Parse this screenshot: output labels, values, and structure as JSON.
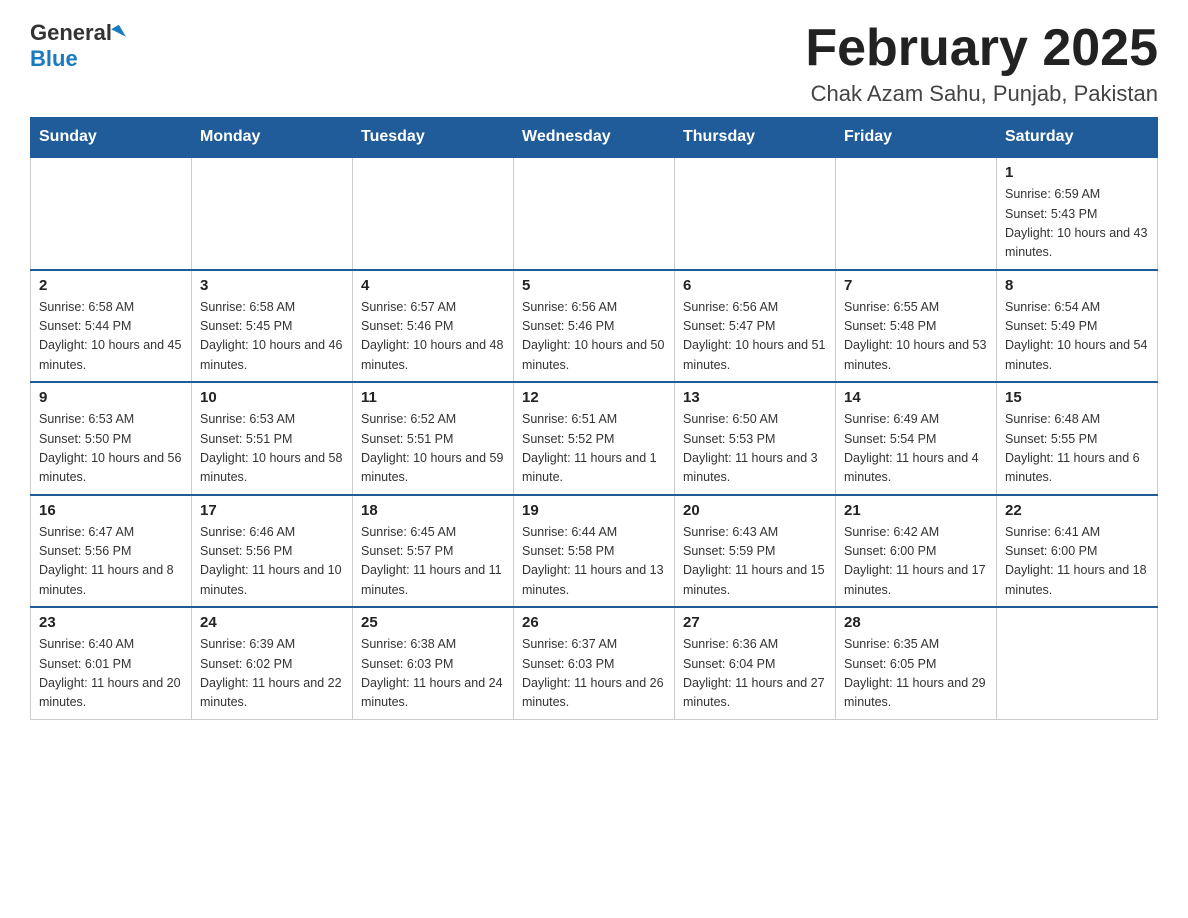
{
  "header": {
    "logo_general": "General",
    "logo_blue": "Blue",
    "title": "February 2025",
    "subtitle": "Chak Azam Sahu, Punjab, Pakistan"
  },
  "days_of_week": [
    "Sunday",
    "Monday",
    "Tuesday",
    "Wednesday",
    "Thursday",
    "Friday",
    "Saturday"
  ],
  "weeks": [
    [
      {
        "day": "",
        "info": ""
      },
      {
        "day": "",
        "info": ""
      },
      {
        "day": "",
        "info": ""
      },
      {
        "day": "",
        "info": ""
      },
      {
        "day": "",
        "info": ""
      },
      {
        "day": "",
        "info": ""
      },
      {
        "day": "1",
        "info": "Sunrise: 6:59 AM\nSunset: 5:43 PM\nDaylight: 10 hours and 43 minutes."
      }
    ],
    [
      {
        "day": "2",
        "info": "Sunrise: 6:58 AM\nSunset: 5:44 PM\nDaylight: 10 hours and 45 minutes."
      },
      {
        "day": "3",
        "info": "Sunrise: 6:58 AM\nSunset: 5:45 PM\nDaylight: 10 hours and 46 minutes."
      },
      {
        "day": "4",
        "info": "Sunrise: 6:57 AM\nSunset: 5:46 PM\nDaylight: 10 hours and 48 minutes."
      },
      {
        "day": "5",
        "info": "Sunrise: 6:56 AM\nSunset: 5:46 PM\nDaylight: 10 hours and 50 minutes."
      },
      {
        "day": "6",
        "info": "Sunrise: 6:56 AM\nSunset: 5:47 PM\nDaylight: 10 hours and 51 minutes."
      },
      {
        "day": "7",
        "info": "Sunrise: 6:55 AM\nSunset: 5:48 PM\nDaylight: 10 hours and 53 minutes."
      },
      {
        "day": "8",
        "info": "Sunrise: 6:54 AM\nSunset: 5:49 PM\nDaylight: 10 hours and 54 minutes."
      }
    ],
    [
      {
        "day": "9",
        "info": "Sunrise: 6:53 AM\nSunset: 5:50 PM\nDaylight: 10 hours and 56 minutes."
      },
      {
        "day": "10",
        "info": "Sunrise: 6:53 AM\nSunset: 5:51 PM\nDaylight: 10 hours and 58 minutes."
      },
      {
        "day": "11",
        "info": "Sunrise: 6:52 AM\nSunset: 5:51 PM\nDaylight: 10 hours and 59 minutes."
      },
      {
        "day": "12",
        "info": "Sunrise: 6:51 AM\nSunset: 5:52 PM\nDaylight: 11 hours and 1 minute."
      },
      {
        "day": "13",
        "info": "Sunrise: 6:50 AM\nSunset: 5:53 PM\nDaylight: 11 hours and 3 minutes."
      },
      {
        "day": "14",
        "info": "Sunrise: 6:49 AM\nSunset: 5:54 PM\nDaylight: 11 hours and 4 minutes."
      },
      {
        "day": "15",
        "info": "Sunrise: 6:48 AM\nSunset: 5:55 PM\nDaylight: 11 hours and 6 minutes."
      }
    ],
    [
      {
        "day": "16",
        "info": "Sunrise: 6:47 AM\nSunset: 5:56 PM\nDaylight: 11 hours and 8 minutes."
      },
      {
        "day": "17",
        "info": "Sunrise: 6:46 AM\nSunset: 5:56 PM\nDaylight: 11 hours and 10 minutes."
      },
      {
        "day": "18",
        "info": "Sunrise: 6:45 AM\nSunset: 5:57 PM\nDaylight: 11 hours and 11 minutes."
      },
      {
        "day": "19",
        "info": "Sunrise: 6:44 AM\nSunset: 5:58 PM\nDaylight: 11 hours and 13 minutes."
      },
      {
        "day": "20",
        "info": "Sunrise: 6:43 AM\nSunset: 5:59 PM\nDaylight: 11 hours and 15 minutes."
      },
      {
        "day": "21",
        "info": "Sunrise: 6:42 AM\nSunset: 6:00 PM\nDaylight: 11 hours and 17 minutes."
      },
      {
        "day": "22",
        "info": "Sunrise: 6:41 AM\nSunset: 6:00 PM\nDaylight: 11 hours and 18 minutes."
      }
    ],
    [
      {
        "day": "23",
        "info": "Sunrise: 6:40 AM\nSunset: 6:01 PM\nDaylight: 11 hours and 20 minutes."
      },
      {
        "day": "24",
        "info": "Sunrise: 6:39 AM\nSunset: 6:02 PM\nDaylight: 11 hours and 22 minutes."
      },
      {
        "day": "25",
        "info": "Sunrise: 6:38 AM\nSunset: 6:03 PM\nDaylight: 11 hours and 24 minutes."
      },
      {
        "day": "26",
        "info": "Sunrise: 6:37 AM\nSunset: 6:03 PM\nDaylight: 11 hours and 26 minutes."
      },
      {
        "day": "27",
        "info": "Sunrise: 6:36 AM\nSunset: 6:04 PM\nDaylight: 11 hours and 27 minutes."
      },
      {
        "day": "28",
        "info": "Sunrise: 6:35 AM\nSunset: 6:05 PM\nDaylight: 11 hours and 29 minutes."
      },
      {
        "day": "",
        "info": ""
      }
    ]
  ]
}
